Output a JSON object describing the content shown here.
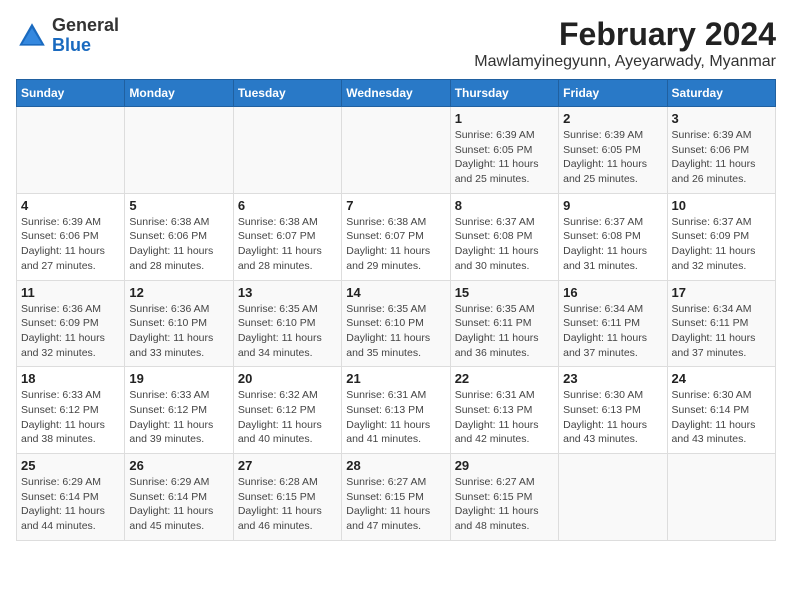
{
  "header": {
    "logo_line1": "General",
    "logo_line2": "Blue",
    "title": "February 2024",
    "subtitle": "Mawlamyinegyunn, Ayeyarwady, Myanmar"
  },
  "days_of_week": [
    "Sunday",
    "Monday",
    "Tuesday",
    "Wednesday",
    "Thursday",
    "Friday",
    "Saturday"
  ],
  "weeks": [
    [
      {
        "day": "",
        "info": ""
      },
      {
        "day": "",
        "info": ""
      },
      {
        "day": "",
        "info": ""
      },
      {
        "day": "",
        "info": ""
      },
      {
        "day": "1",
        "info": "Sunrise: 6:39 AM\nSunset: 6:05 PM\nDaylight: 11 hours and 25 minutes."
      },
      {
        "day": "2",
        "info": "Sunrise: 6:39 AM\nSunset: 6:05 PM\nDaylight: 11 hours and 25 minutes."
      },
      {
        "day": "3",
        "info": "Sunrise: 6:39 AM\nSunset: 6:06 PM\nDaylight: 11 hours and 26 minutes."
      }
    ],
    [
      {
        "day": "4",
        "info": "Sunrise: 6:39 AM\nSunset: 6:06 PM\nDaylight: 11 hours and 27 minutes."
      },
      {
        "day": "5",
        "info": "Sunrise: 6:38 AM\nSunset: 6:06 PM\nDaylight: 11 hours and 28 minutes."
      },
      {
        "day": "6",
        "info": "Sunrise: 6:38 AM\nSunset: 6:07 PM\nDaylight: 11 hours and 28 minutes."
      },
      {
        "day": "7",
        "info": "Sunrise: 6:38 AM\nSunset: 6:07 PM\nDaylight: 11 hours and 29 minutes."
      },
      {
        "day": "8",
        "info": "Sunrise: 6:37 AM\nSunset: 6:08 PM\nDaylight: 11 hours and 30 minutes."
      },
      {
        "day": "9",
        "info": "Sunrise: 6:37 AM\nSunset: 6:08 PM\nDaylight: 11 hours and 31 minutes."
      },
      {
        "day": "10",
        "info": "Sunrise: 6:37 AM\nSunset: 6:09 PM\nDaylight: 11 hours and 32 minutes."
      }
    ],
    [
      {
        "day": "11",
        "info": "Sunrise: 6:36 AM\nSunset: 6:09 PM\nDaylight: 11 hours and 32 minutes."
      },
      {
        "day": "12",
        "info": "Sunrise: 6:36 AM\nSunset: 6:10 PM\nDaylight: 11 hours and 33 minutes."
      },
      {
        "day": "13",
        "info": "Sunrise: 6:35 AM\nSunset: 6:10 PM\nDaylight: 11 hours and 34 minutes."
      },
      {
        "day": "14",
        "info": "Sunrise: 6:35 AM\nSunset: 6:10 PM\nDaylight: 11 hours and 35 minutes."
      },
      {
        "day": "15",
        "info": "Sunrise: 6:35 AM\nSunset: 6:11 PM\nDaylight: 11 hours and 36 minutes."
      },
      {
        "day": "16",
        "info": "Sunrise: 6:34 AM\nSunset: 6:11 PM\nDaylight: 11 hours and 37 minutes."
      },
      {
        "day": "17",
        "info": "Sunrise: 6:34 AM\nSunset: 6:11 PM\nDaylight: 11 hours and 37 minutes."
      }
    ],
    [
      {
        "day": "18",
        "info": "Sunrise: 6:33 AM\nSunset: 6:12 PM\nDaylight: 11 hours and 38 minutes."
      },
      {
        "day": "19",
        "info": "Sunrise: 6:33 AM\nSunset: 6:12 PM\nDaylight: 11 hours and 39 minutes."
      },
      {
        "day": "20",
        "info": "Sunrise: 6:32 AM\nSunset: 6:12 PM\nDaylight: 11 hours and 40 minutes."
      },
      {
        "day": "21",
        "info": "Sunrise: 6:31 AM\nSunset: 6:13 PM\nDaylight: 11 hours and 41 minutes."
      },
      {
        "day": "22",
        "info": "Sunrise: 6:31 AM\nSunset: 6:13 PM\nDaylight: 11 hours and 42 minutes."
      },
      {
        "day": "23",
        "info": "Sunrise: 6:30 AM\nSunset: 6:13 PM\nDaylight: 11 hours and 43 minutes."
      },
      {
        "day": "24",
        "info": "Sunrise: 6:30 AM\nSunset: 6:14 PM\nDaylight: 11 hours and 43 minutes."
      }
    ],
    [
      {
        "day": "25",
        "info": "Sunrise: 6:29 AM\nSunset: 6:14 PM\nDaylight: 11 hours and 44 minutes."
      },
      {
        "day": "26",
        "info": "Sunrise: 6:29 AM\nSunset: 6:14 PM\nDaylight: 11 hours and 45 minutes."
      },
      {
        "day": "27",
        "info": "Sunrise: 6:28 AM\nSunset: 6:15 PM\nDaylight: 11 hours and 46 minutes."
      },
      {
        "day": "28",
        "info": "Sunrise: 6:27 AM\nSunset: 6:15 PM\nDaylight: 11 hours and 47 minutes."
      },
      {
        "day": "29",
        "info": "Sunrise: 6:27 AM\nSunset: 6:15 PM\nDaylight: 11 hours and 48 minutes."
      },
      {
        "day": "",
        "info": ""
      },
      {
        "day": "",
        "info": ""
      }
    ]
  ]
}
